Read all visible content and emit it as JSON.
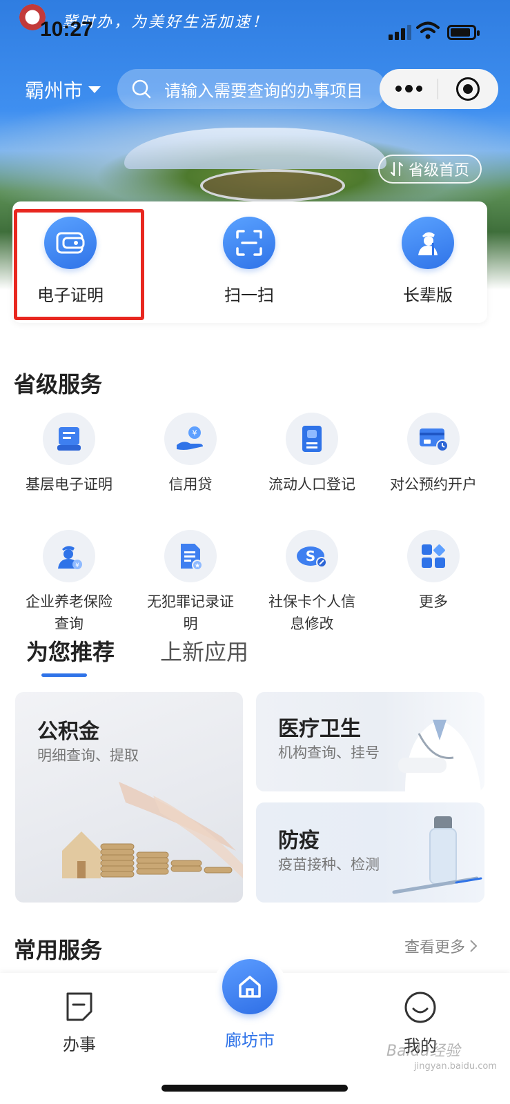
{
  "status_bar": {
    "time": "10:27",
    "slogan": "冀时办，为美好生活加速！"
  },
  "header": {
    "city": "霸州市",
    "search_placeholder": "请输入需要查询的办事项目",
    "province_home": "省级首页"
  },
  "quick_actions": [
    {
      "label": "电子证明",
      "icon": "wallet-card-icon"
    },
    {
      "label": "扫一扫",
      "icon": "scan-icon"
    },
    {
      "label": "长辈版",
      "icon": "elder-mode-icon"
    }
  ],
  "provincial_services": {
    "title": "省级服务",
    "items": [
      {
        "label": "基层电子证明",
        "icon": "certificate-icon"
      },
      {
        "label": "信用贷",
        "icon": "credit-loan-icon"
      },
      {
        "label": "流动人口登记",
        "icon": "registration-book-icon"
      },
      {
        "label": "对公预约开户",
        "icon": "account-card-icon"
      },
      {
        "label_line1": "企业养老保险",
        "label_line2": "查询",
        "icon": "pension-icon"
      },
      {
        "label_line1": "无犯罪记录证",
        "label_line2": "明",
        "icon": "record-document-icon"
      },
      {
        "label_line1": "社保卡个人信",
        "label_line2": "息修改",
        "icon": "social-security-icon"
      },
      {
        "label": "更多",
        "icon": "more-apps-icon"
      }
    ]
  },
  "recommend_tabs": [
    {
      "label": "为您推荐",
      "active": true
    },
    {
      "label": "上新应用",
      "active": false
    }
  ],
  "recommend_cards": [
    {
      "title": "公积金",
      "subtitle": "明细查询、提取"
    },
    {
      "title": "医疗卫生",
      "subtitle": "机构查询、挂号"
    },
    {
      "title": "防疫",
      "subtitle": "疫苗接种、检测"
    }
  ],
  "common_services": {
    "title": "常用服务",
    "more": "查看更多"
  },
  "tabbar": {
    "items": [
      {
        "label": "办事",
        "icon": "document-icon"
      },
      {
        "label": "廊坊市",
        "icon": "home-icon"
      },
      {
        "label": "我的",
        "icon": "smile-icon"
      }
    ]
  },
  "colors": {
    "primary": "#2f73e8",
    "highlight": "#e8271f",
    "hero_sky": "#3f8ff0"
  },
  "watermark": {
    "text": "Baidu经验",
    "sub": "jingyan.baidu.com"
  }
}
